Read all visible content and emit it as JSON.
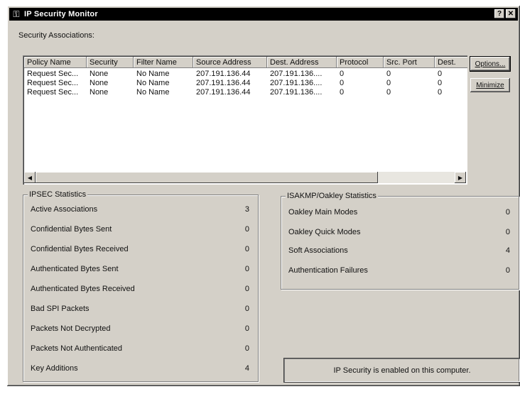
{
  "window": {
    "title": "IP Security Monitor",
    "help_glyph": "?",
    "close_glyph": "✕",
    "icon": "ip-security-icon",
    "icon_glyph": "⚿"
  },
  "security_associations": {
    "label": "Security Associations:",
    "columns": [
      "Policy Name",
      "Security",
      "Filter Name",
      "Source Address",
      "Dest. Address",
      "Protocol",
      "Src. Port",
      "Dest."
    ],
    "rows": [
      [
        "Request Sec...",
        "None",
        "No Name",
        "207.191.136.44",
        "207.191.136....",
        "0",
        "0",
        "0"
      ],
      [
        "Request Sec...",
        "None",
        "No Name",
        "207.191.136.44",
        "207.191.136....",
        "0",
        "0",
        "0"
      ],
      [
        "Request Sec...",
        "None",
        "No Name",
        "207.191.136.44",
        "207.191.136....",
        "0",
        "0",
        "0"
      ]
    ],
    "scroll_left_glyph": "◀",
    "scroll_right_glyph": "▶"
  },
  "buttons": {
    "options": "Options...",
    "minimize": "Minimize"
  },
  "ipsec_stats": {
    "title": "IPSEC Statistics",
    "items": [
      {
        "label": "Active Associations",
        "value": "3"
      },
      {
        "label": "Confidential Bytes Sent",
        "value": "0"
      },
      {
        "label": "Confidential Bytes Received",
        "value": "0"
      },
      {
        "label": "Authenticated Bytes Sent",
        "value": "0"
      },
      {
        "label": "Authenticated Bytes Received",
        "value": "0"
      },
      {
        "label": "Bad SPI Packets",
        "value": "0"
      },
      {
        "label": "Packets Not Decrypted",
        "value": "0"
      },
      {
        "label": "Packets Not Authenticated",
        "value": "0"
      },
      {
        "label": "Key Additions",
        "value": "4"
      }
    ]
  },
  "isakmp_stats": {
    "title": "ISAKMP/Oakley Statistics",
    "items": [
      {
        "label": "Oakley Main Modes",
        "value": "0"
      },
      {
        "label": "Oakley Quick Modes",
        "value": "0"
      },
      {
        "label": "Soft Associations",
        "value": "4"
      },
      {
        "label": "Authentication Failures",
        "value": "0"
      }
    ]
  },
  "status": {
    "text": "IP Security is enabled on this computer."
  }
}
